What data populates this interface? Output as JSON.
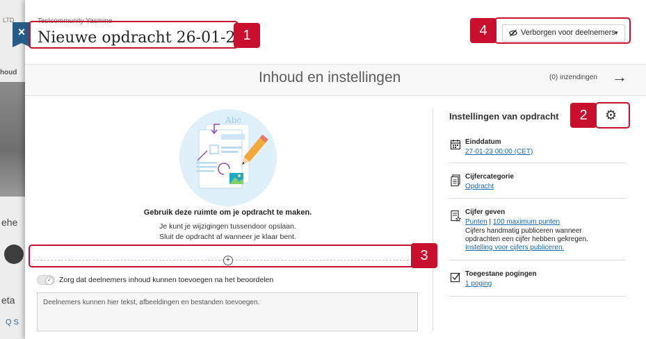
{
  "background": {
    "tab_fragment": "houd",
    "text_fragment_1": "ehe",
    "text_fragment_2": "eta",
    "text_fragment_3": "Q S",
    "logo_fragment": "LTD"
  },
  "header": {
    "breadcrumb": "Testcommunity Yasmine",
    "title": "Nieuwe opdracht 26-01-23",
    "close_label": "×",
    "visibility_label": "Verborgen voor deelnemers",
    "visibility_icon": "eye-slash-icon"
  },
  "subheader": {
    "title": "Inhoud en instellingen",
    "submissions": "(0) inzendingen",
    "arrow": "→"
  },
  "content": {
    "heading": "Gebruik deze ruimte om je opdracht te maken.",
    "line1": "Je kunt je wijzigingen tussendoor opslaan.",
    "line2": "Sluit de opdracht af wanneer je klaar bent.",
    "illustration_text": "Abc",
    "add_icon": "⊕",
    "toggle_label": "Zorg dat deelnemers inhoud kunnen toevoegen na het beoordelen",
    "textarea_placeholder": "Deelnemers kunnen hier tekst, afbeeldingen en bestanden toevoegen."
  },
  "settings": {
    "title": "Instellingen van opdracht",
    "gear_icon": "gear-icon",
    "due_label": "Einddatum",
    "due_value": "27-01-23 00:00 (CET)",
    "category_label": "Cijfercategorie",
    "category_value": "Opdracht",
    "grading_label": "Cijfer geven",
    "grading_points": "Punten",
    "grading_sep": "|",
    "grading_max": "100 maximum punten",
    "grading_note1": "Cijfers handmatig publiceren wanneer",
    "grading_note2": "opdrachten een cijfer hebben gekregen.",
    "grading_publish": "Instelling voor cijfers publiceren.",
    "attempts_label": "Toegestane pogingen",
    "attempts_value": "1 poging"
  },
  "callouts": [
    "1",
    "2",
    "3",
    "4"
  ],
  "colors": {
    "accent": "#c8102e",
    "link": "#1b6bb0",
    "close_tab": "#255b87"
  }
}
